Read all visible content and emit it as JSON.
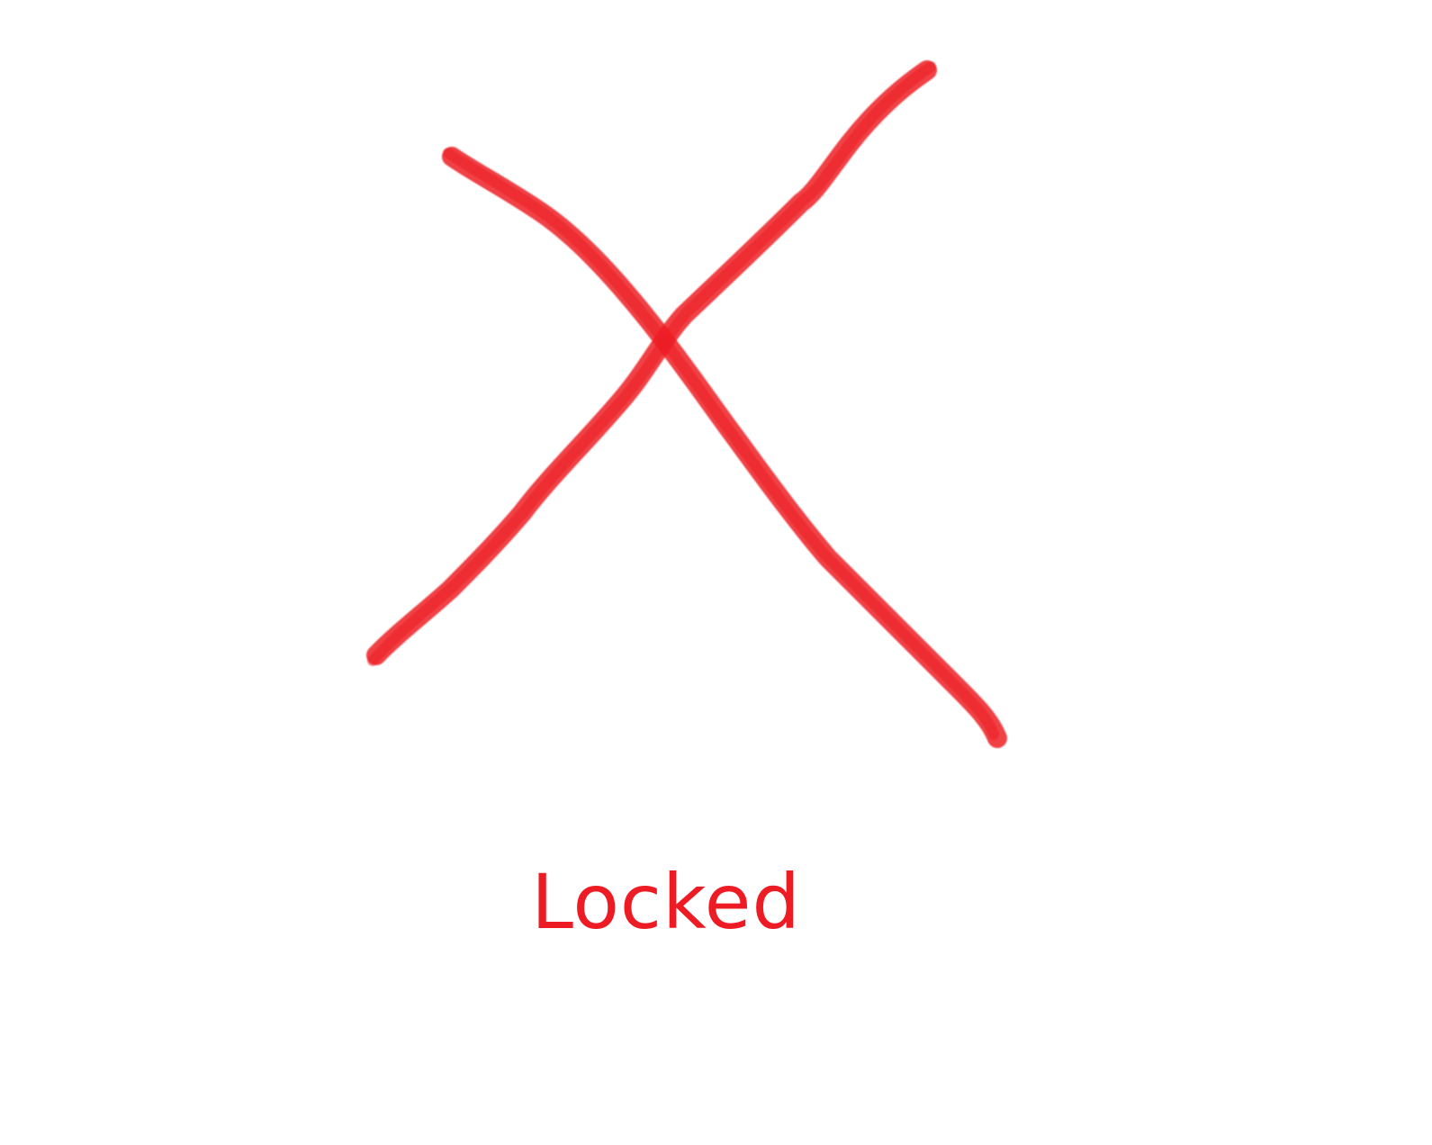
{
  "status": {
    "label": "Locked",
    "color": "#ed1c24"
  },
  "mark": {
    "icon": "red-x-cross-icon",
    "color": "#ed1c24"
  }
}
